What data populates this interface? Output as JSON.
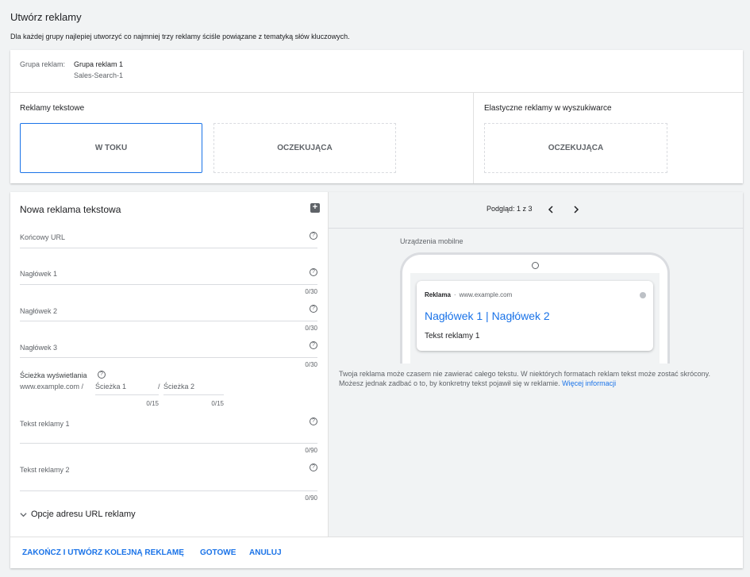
{
  "page": {
    "title": "Utwórz reklamy",
    "subtitle": "Dla każdej grupy najlepiej utworzyć co najmniej trzy reklamy ściśle powiązane z tematyką słów kluczowych."
  },
  "ad_group": {
    "label": "Grupa reklam:",
    "name": "Grupa reklam 1",
    "campaign": "Sales-Search-1"
  },
  "text_ads": {
    "label": "Reklamy tekstowe",
    "tiles": [
      {
        "label": "W TOKU",
        "state": "active"
      },
      {
        "label": "OCZEKUJĄCA",
        "state": "pending"
      }
    ]
  },
  "responsive_ads": {
    "label": "Elastyczne reklamy w wyszukiwarce",
    "tiles": [
      {
        "label": "OCZEKUJĄCA",
        "state": "pending"
      }
    ]
  },
  "editor": {
    "heading": "Nowa reklama tekstowa",
    "fields": {
      "final_url": {
        "label": "Końcowy URL"
      },
      "headline1": {
        "label": "Nagłówek 1",
        "counter": "0/30"
      },
      "headline2": {
        "label": "Nagłówek 2",
        "counter": "0/30"
      },
      "headline3": {
        "label": "Nagłówek 3",
        "counter": "0/30"
      },
      "display_path": {
        "label": "Ścieżka wyświetlania",
        "domain": "www.example.com /",
        "path1_placeholder": "Ścieżka 1",
        "path2_separator": "/",
        "path2_placeholder": "Ścieżka 2",
        "path1_counter": "0/15",
        "path2_counter": "0/15"
      },
      "description1": {
        "label": "Tekst reklamy 1",
        "counter": "0/90"
      },
      "description2": {
        "label": "Tekst reklamy 2",
        "counter": "0/90"
      }
    },
    "url_options_label": "Opcje adresu URL reklamy"
  },
  "preview": {
    "pagination": "Podgląd: 1 z 3",
    "device_label": "Urządzenia mobilne",
    "ad_badge": "Reklama",
    "ad_separator": "·",
    "ad_domain": "www.example.com",
    "ad_headline": "Nagłówek 1 | Nagłówek 2",
    "ad_description": "Tekst reklamy 1",
    "note": "Twoja reklama może czasem nie zawierać całego tekstu. W niektórych formatach reklam tekst może zostać skrócony. Możesz jednak zadbać o to, by konkretny tekst pojawił się w reklamie.",
    "note_link": "Więcej informacji"
  },
  "footer": {
    "save_and_new": "ZAKOŃCZ I UTWÓRZ KOLEJNĄ REKLAMĘ",
    "done": "GOTOWE",
    "cancel": "ANULUJ"
  },
  "colors": {
    "accent": "#1a73e8",
    "ad_headline": "#1a0dab"
  },
  "icons": {
    "help": "help-icon",
    "add_ad": "add-comment-icon",
    "prev": "chevron-left-icon",
    "next": "chevron-right-icon",
    "expand": "chevron-down-icon",
    "info": "info-icon"
  }
}
